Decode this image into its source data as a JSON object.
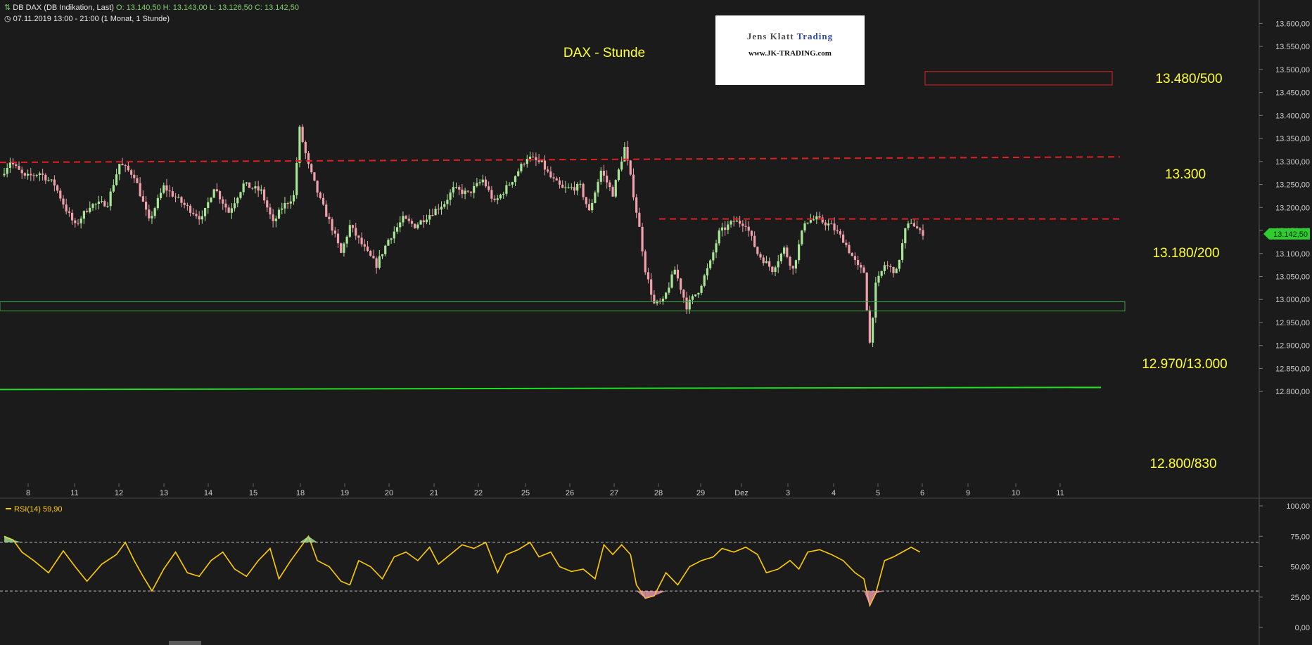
{
  "header": {
    "instrument": "DB DAX (DB Indikation, Last)",
    "ohlc": "O: 13.140,50  H: 13.143,00  L: 13.126,50  C: 13.142,50",
    "range": "07.11.2019 13:00 - 21:00  (1 Monat, 1 Stunde)"
  },
  "logo": {
    "line1a": "Jens Klatt ",
    "line1b": "Trading",
    "line2": "www.JK-TRADING.com"
  },
  "colors": {
    "bg": "#1b1b1b",
    "up": "#a9e596",
    "down": "#f0a0aa",
    "annotation": "#ffff33",
    "resistance": "#e02020",
    "support": "#22dd22",
    "rsi": "#ffcc00",
    "axis": "#cfcfcf"
  },
  "chart_data": [
    {
      "type": "candlestick",
      "title": "DAX - Stunde",
      "y_axis": {
        "ylim": [
          12785,
          13625
        ],
        "ticks": [
          "13.600,00",
          "13.550,00",
          "13.500,00",
          "13.450,00",
          "13.400,00",
          "13.350,00",
          "13.300,00",
          "13.250,00",
          "13.200,00",
          "13.150,00",
          "13.100,00",
          "13.050,00",
          "13.000,00",
          "12.950,00",
          "12.900,00",
          "12.850,00",
          "12.800,00"
        ],
        "position": "right"
      },
      "x_axis": {
        "ticks": [
          "8",
          "11",
          "12",
          "13",
          "14",
          "15",
          "18",
          "19",
          "20",
          "21",
          "22",
          "25",
          "26",
          "27",
          "28",
          "29",
          "Dez",
          "3",
          "4",
          "5",
          "6",
          "9",
          "10",
          "11"
        ]
      },
      "last_price": "13.142,50",
      "anchors": [
        [
          0,
          13270
        ],
        [
          3,
          13300
        ],
        [
          8,
          13265
        ],
        [
          13,
          13275
        ],
        [
          18,
          13250
        ],
        [
          22,
          13195
        ],
        [
          25,
          13160
        ],
        [
          30,
          13205
        ],
        [
          36,
          13210
        ],
        [
          40,
          13295
        ],
        [
          45,
          13270
        ],
        [
          50,
          13170
        ],
        [
          55,
          13245
        ],
        [
          62,
          13205
        ],
        [
          68,
          13175
        ],
        [
          72,
          13245
        ],
        [
          77,
          13190
        ],
        [
          82,
          13250
        ],
        [
          88,
          13235
        ],
        [
          92,
          13165
        ],
        [
          95,
          13200
        ],
        [
          99,
          13225
        ],
        [
          101,
          13370
        ],
        [
          104,
          13290
        ],
        [
          108,
          13215
        ],
        [
          112,
          13155
        ],
        [
          115,
          13100
        ],
        [
          118,
          13160
        ],
        [
          124,
          13100
        ],
        [
          127,
          13075
        ],
        [
          131,
          13130
        ],
        [
          136,
          13175
        ],
        [
          140,
          13160
        ],
        [
          146,
          13190
        ],
        [
          150,
          13210
        ],
        [
          153,
          13240
        ],
        [
          158,
          13230
        ],
        [
          163,
          13260
        ],
        [
          167,
          13210
        ],
        [
          173,
          13260
        ],
        [
          178,
          13310
        ],
        [
          183,
          13295
        ],
        [
          186,
          13265
        ],
        [
          190,
          13240
        ],
        [
          196,
          13245
        ],
        [
          199,
          13190
        ],
        [
          203,
          13280
        ],
        [
          207,
          13230
        ],
        [
          211,
          13330
        ],
        [
          213,
          13265
        ],
        [
          216,
          13155
        ],
        [
          218,
          13065
        ],
        [
          221,
          12990
        ],
        [
          224,
          12995
        ],
        [
          228,
          13065
        ],
        [
          232,
          12985
        ],
        [
          236,
          13020
        ],
        [
          240,
          13080
        ],
        [
          243,
          13145
        ],
        [
          248,
          13170
        ],
        [
          252,
          13165
        ],
        [
          256,
          13100
        ],
        [
          261,
          13065
        ],
        [
          265,
          13110
        ],
        [
          268,
          13065
        ],
        [
          272,
          13170
        ],
        [
          276,
          13175
        ],
        [
          281,
          13160
        ],
        [
          285,
          13130
        ],
        [
          290,
          13070
        ],
        [
          292,
          13060
        ],
        [
          294,
          12905
        ],
        [
          296,
          13030
        ],
        [
          299,
          13075
        ],
        [
          303,
          13060
        ],
        [
          306,
          13150
        ],
        [
          308,
          13170
        ],
        [
          311,
          13145
        ]
      ],
      "annotations": [
        {
          "text": "13.480/500",
          "kind": "zone",
          "y0": 13480,
          "y1": 13500
        },
        {
          "text": "13.300",
          "kind": "resistance",
          "y_start": 13298,
          "y_end": 13310
        },
        {
          "text": "13.180/200",
          "kind": "resistance",
          "y": 13175
        },
        {
          "text": "12.970/13.000",
          "kind": "zone",
          "y0": 12975,
          "y1": 12995
        },
        {
          "text": "12.800/830",
          "kind": "support",
          "y_start": 12812,
          "y_end": 12815
        }
      ]
    },
    {
      "type": "line",
      "name": "RSI(14)",
      "legend_value": "59,90",
      "ylim": [
        0,
        100
      ],
      "ticks": [
        "100,00",
        "75,00",
        "50,00",
        "25,00",
        "0,00"
      ],
      "levels": [
        70,
        30
      ],
      "points": [
        [
          0,
          75
        ],
        [
          3,
          72
        ],
        [
          6,
          62
        ],
        [
          10,
          55
        ],
        [
          15,
          45
        ],
        [
          20,
          63
        ],
        [
          24,
          50
        ],
        [
          28,
          38
        ],
        [
          33,
          52
        ],
        [
          38,
          60
        ],
        [
          41,
          70
        ],
        [
          44,
          55
        ],
        [
          47,
          42
        ],
        [
          50,
          30
        ],
        [
          54,
          48
        ],
        [
          58,
          62
        ],
        [
          62,
          45
        ],
        [
          66,
          42
        ],
        [
          70,
          55
        ],
        [
          74,
          62
        ],
        [
          78,
          48
        ],
        [
          82,
          42
        ],
        [
          86,
          55
        ],
        [
          90,
          65
        ],
        [
          93,
          40
        ],
        [
          97,
          55
        ],
        [
          100,
          65
        ],
        [
          103,
          75
        ],
        [
          106,
          55
        ],
        [
          110,
          50
        ],
        [
          114,
          38
        ],
        [
          117,
          35
        ],
        [
          120,
          55
        ],
        [
          124,
          50
        ],
        [
          128,
          40
        ],
        [
          132,
          58
        ],
        [
          136,
          62
        ],
        [
          140,
          55
        ],
        [
          144,
          66
        ],
        [
          147,
          52
        ],
        [
          151,
          60
        ],
        [
          155,
          68
        ],
        [
          159,
          65
        ],
        [
          163,
          70
        ],
        [
          167,
          45
        ],
        [
          170,
          60
        ],
        [
          174,
          64
        ],
        [
          178,
          70
        ],
        [
          181,
          58
        ],
        [
          185,
          62
        ],
        [
          188,
          50
        ],
        [
          192,
          46
        ],
        [
          196,
          48
        ],
        [
          200,
          40
        ],
        [
          203,
          68
        ],
        [
          206,
          60
        ],
        [
          209,
          68
        ],
        [
          212,
          60
        ],
        [
          214,
          35
        ],
        [
          217,
          24
        ],
        [
          220,
          26
        ],
        [
          224,
          45
        ],
        [
          228,
          35
        ],
        [
          232,
          50
        ],
        [
          236,
          55
        ],
        [
          240,
          58
        ],
        [
          243,
          65
        ],
        [
          247,
          62
        ],
        [
          251,
          66
        ],
        [
          255,
          60
        ],
        [
          258,
          45
        ],
        [
          262,
          48
        ],
        [
          266,
          55
        ],
        [
          269,
          48
        ],
        [
          272,
          62
        ],
        [
          276,
          64
        ],
        [
          280,
          60
        ],
        [
          284,
          55
        ],
        [
          288,
          45
        ],
        [
          291,
          40
        ],
        [
          293,
          18
        ],
        [
          295,
          28
        ],
        [
          298,
          55
        ],
        [
          301,
          58
        ],
        [
          304,
          62
        ],
        [
          307,
          66
        ],
        [
          310,
          62
        ]
      ]
    }
  ]
}
